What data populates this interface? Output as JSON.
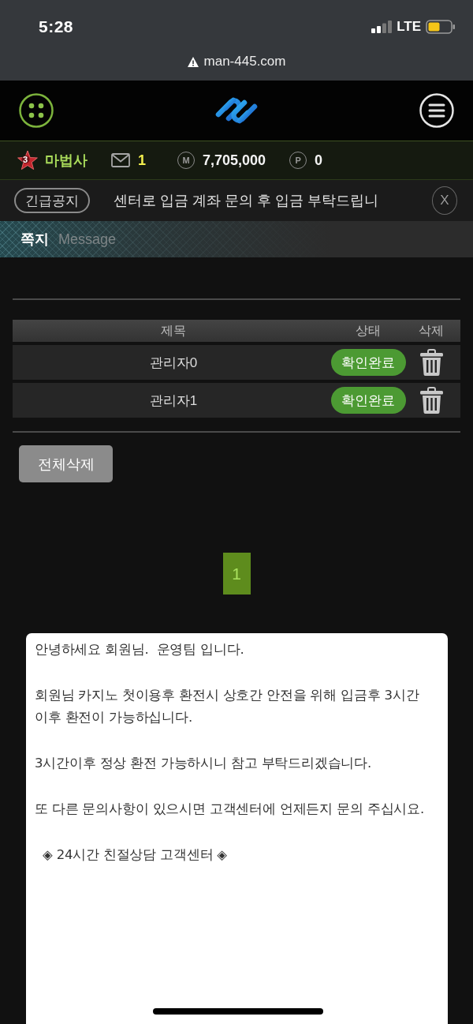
{
  "status_bar": {
    "time": "5:28",
    "network": "LTE"
  },
  "address_bar": {
    "url": "man-445.com"
  },
  "user_bar": {
    "rank": "3",
    "nickname": "마법사",
    "messages": "1",
    "money_symbol": "M",
    "money": "7,705,000",
    "points_symbol": "P",
    "points": "0"
  },
  "notice": {
    "label": "긴급공지",
    "text": "센터로 입금 계좌 문의 후 입금 부탁드립니",
    "close": "X"
  },
  "page_title": {
    "title": "쪽지",
    "subtitle": "Message"
  },
  "table": {
    "columns": [
      "제목",
      "상태",
      "삭제"
    ],
    "rows": [
      {
        "title": "관리자0",
        "status": "확인완료"
      },
      {
        "title": "관리자1",
        "status": "확인완료"
      }
    ]
  },
  "delete_all_button": "전체삭제",
  "pagination": [
    {
      "label": "1",
      "selected": true
    }
  ],
  "popup": {
    "paragraphs": [
      "안녕하세요 회원님.  운영팀 입니다.",
      "회원님 카지노 첫이용후 환전시 상호간 안전을 위해 입금후 3시간 이후 환전이 가능하십니다.",
      "3시간이후 정상 환전 가능하시니 참고 부탁드리겠습니다.",
      "또 다른 문의사항이 있으시면 고객센터에 언제든지 문의 주십시요.",
      "  ◈ 24시간 친절상담 고객센터 ◈"
    ]
  }
}
